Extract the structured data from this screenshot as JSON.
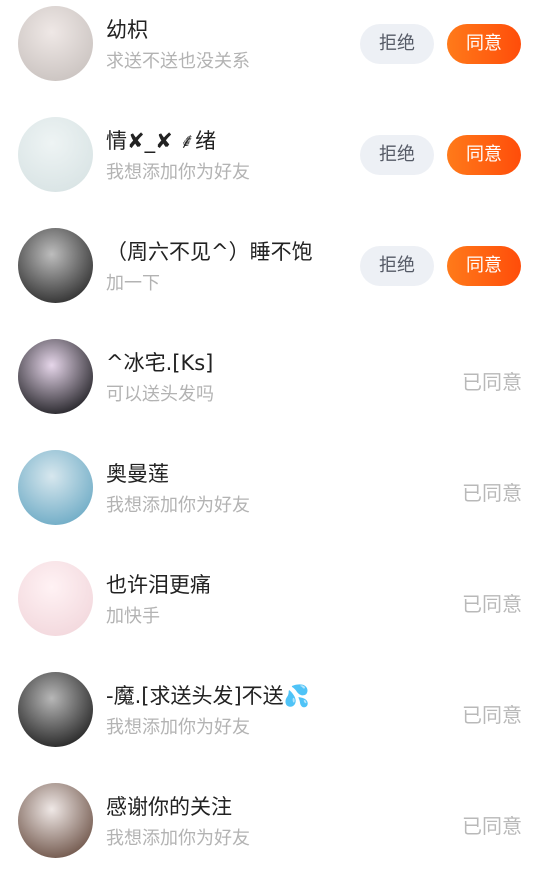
{
  "requests": [
    {
      "name": "幼枳",
      "message": "求送不送也没关系",
      "state": "pending",
      "reject_label": "拒绝",
      "accept_label": "同意",
      "avatar_colors": [
        "#c9c2bf",
        "#efe8e6"
      ]
    },
    {
      "name": "情✘_✘ ⸙绪",
      "message": "我想添加你为好友",
      "state": "pending",
      "reject_label": "拒绝",
      "accept_label": "同意",
      "avatar_colors": [
        "#d8e3e4",
        "#eef4f4"
      ]
    },
    {
      "name": "（周六不见^）睡不饱",
      "message": "加一下",
      "state": "pending",
      "reject_label": "拒绝",
      "accept_label": "同意",
      "avatar_colors": [
        "#2a2a2a",
        "#bdbdbd"
      ]
    },
    {
      "name": "^冰宅.[Ks]",
      "message": "可以送头发吗",
      "state": "accepted",
      "status_label": "已同意",
      "avatar_colors": [
        "#1b1b1f",
        "#e6d6ea"
      ]
    },
    {
      "name": "奥曼莲",
      "message": "我想添加你为好友",
      "state": "accepted",
      "status_label": "已同意",
      "avatar_colors": [
        "#6aa9c4",
        "#d7e7ee"
      ]
    },
    {
      "name": "也许泪更痛",
      "message": "加快手",
      "state": "accepted",
      "status_label": "已同意",
      "avatar_colors": [
        "#f2d7dc",
        "#fff2f4"
      ]
    },
    {
      "name": "-魔.[求送头发]不送💦",
      "message": "我想添加你为好友",
      "state": "accepted",
      "status_label": "已同意",
      "avatar_colors": [
        "#1f1f1f",
        "#b7b7b7"
      ]
    },
    {
      "name": "感谢你的关注",
      "message": "我想添加你为好友",
      "state": "accepted",
      "status_label": "已同意",
      "avatar_colors": [
        "#6a4f43",
        "#efe8e6"
      ]
    }
  ]
}
